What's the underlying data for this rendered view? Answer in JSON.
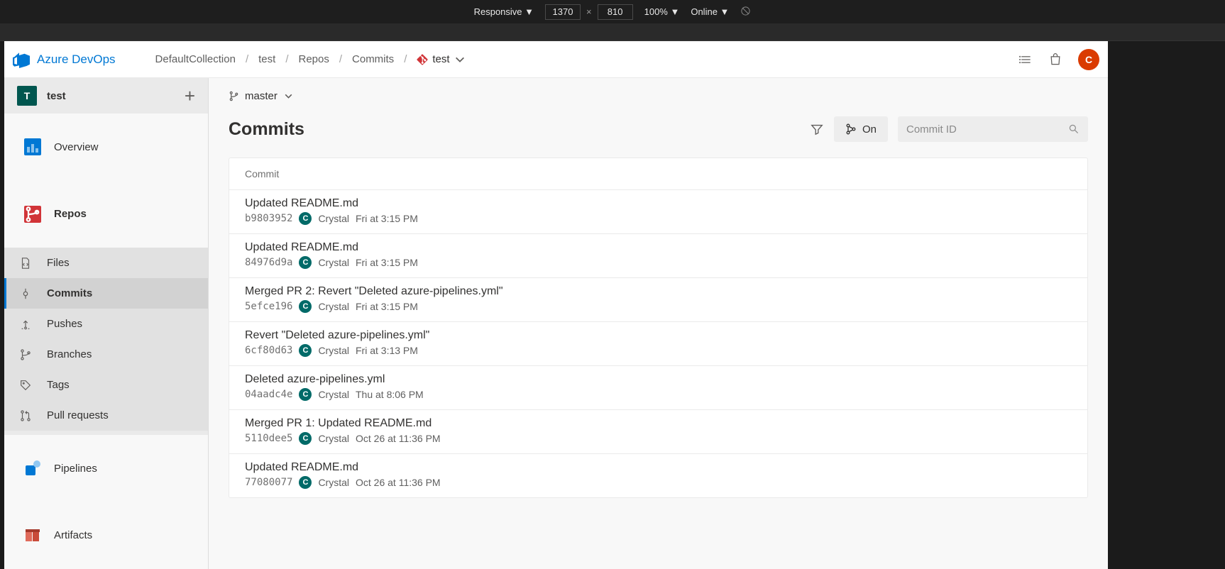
{
  "devToolbar": {
    "responsive": "Responsive",
    "width": "1370",
    "height": "810",
    "zoom": "100%",
    "online": "Online"
  },
  "header": {
    "brand": "Azure DevOps",
    "breadcrumb": {
      "collection": "DefaultCollection",
      "project": "test",
      "area": "Repos",
      "page": "Commits",
      "repo": "test"
    },
    "avatarInitial": "C"
  },
  "sidebar": {
    "projectInitial": "T",
    "projectName": "test",
    "overview": "Overview",
    "repos": "Repos",
    "files": "Files",
    "commits": "Commits",
    "pushes": "Pushes",
    "branches": "Branches",
    "tags": "Tags",
    "pullRequests": "Pull requests",
    "pipelines": "Pipelines",
    "artifacts": "Artifacts"
  },
  "main": {
    "branch": "master",
    "title": "Commits",
    "graphToggle": "On",
    "searchPlaceholder": "Commit ID",
    "listHeader": "Commit",
    "commits": [
      {
        "title": "Updated README.md",
        "hash": "b9803952",
        "author": "Crystal",
        "authorInitial": "C",
        "date": "Fri at 3:15 PM"
      },
      {
        "title": "Updated README.md",
        "hash": "84976d9a",
        "author": "Crystal",
        "authorInitial": "C",
        "date": "Fri at 3:15 PM"
      },
      {
        "title": "Merged PR 2: Revert \"Deleted azure-pipelines.yml\"",
        "hash": "5efce196",
        "author": "Crystal",
        "authorInitial": "C",
        "date": "Fri at 3:15 PM"
      },
      {
        "title": "Revert \"Deleted azure-pipelines.yml\"",
        "hash": "6cf80d63",
        "author": "Crystal",
        "authorInitial": "C",
        "date": "Fri at 3:13 PM"
      },
      {
        "title": "Deleted azure-pipelines.yml",
        "hash": "04aadc4e",
        "author": "Crystal",
        "authorInitial": "C",
        "date": "Thu at 8:06 PM"
      },
      {
        "title": "Merged PR 1: Updated README.md",
        "hash": "5110dee5",
        "author": "Crystal",
        "authorInitial": "C",
        "date": "Oct 26 at 11:36 PM"
      },
      {
        "title": "Updated README.md",
        "hash": "77080077",
        "author": "Crystal",
        "authorInitial": "C",
        "date": "Oct 26 at 11:36 PM"
      }
    ]
  }
}
